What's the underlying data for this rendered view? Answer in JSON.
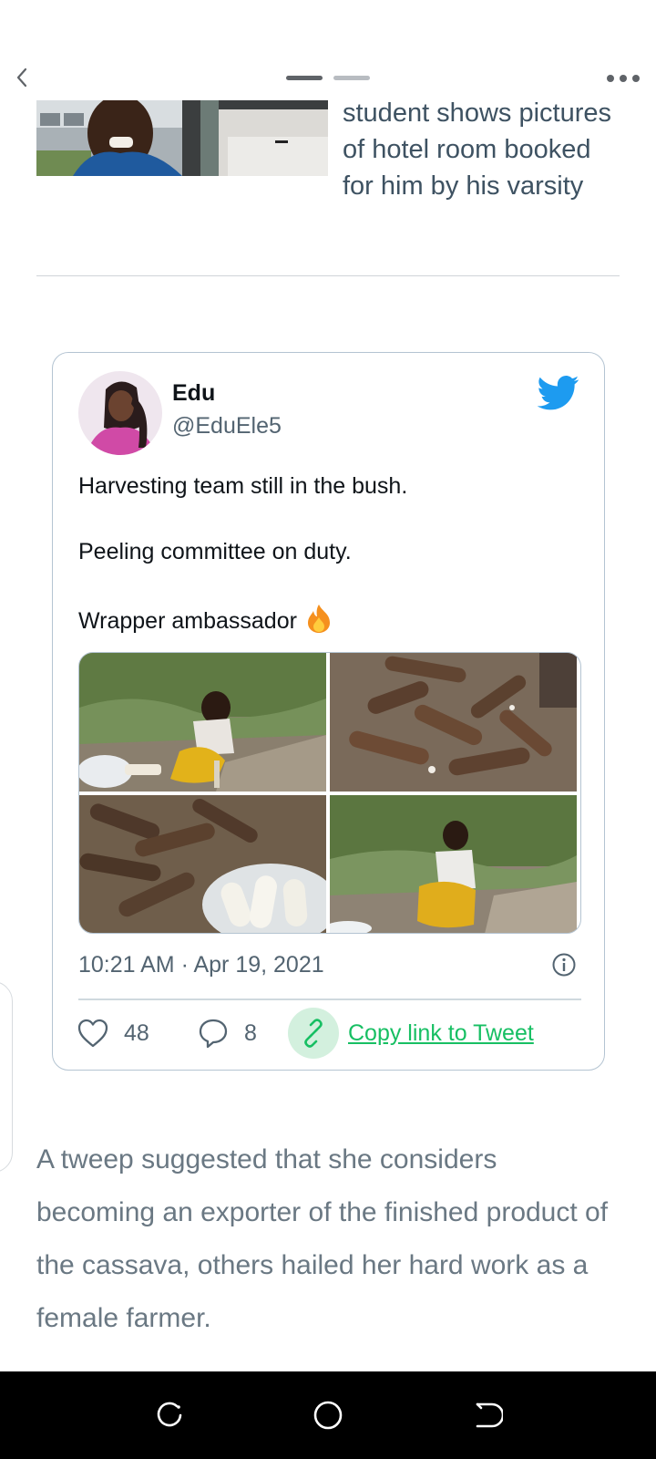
{
  "header": {
    "back_icon": "chevron-left-icon",
    "more_icon": "more-dots-icon",
    "page_indicator": {
      "count": 2,
      "active": 1
    }
  },
  "related": {
    "title": "student shows pictures of hotel room booked for him by his varsity"
  },
  "tweet": {
    "user_name": "Edu",
    "user_handle": "@EduEle5",
    "lines": [
      "Harvesting team still in the bush.",
      "Peeling committee on duty.",
      "Wrapper ambassador"
    ],
    "emoji_icon": "fire-icon",
    "timestamp": "10:21 AM · Apr 19, 2021",
    "likes": "48",
    "replies": "8",
    "copy_link_label": "Copy link to Tweet",
    "brand_color": "#1d9bf0",
    "copy_color": "#17bf63"
  },
  "article": {
    "paragraph": "A tweep suggested that she considers becoming an exporter of the finished product of the cassava, others hailed her hard work as a female farmer."
  },
  "system_nav": {
    "recents_icon": "recents-icon",
    "home_icon": "home-circle-icon",
    "back_icon": "back-arrow-icon"
  }
}
